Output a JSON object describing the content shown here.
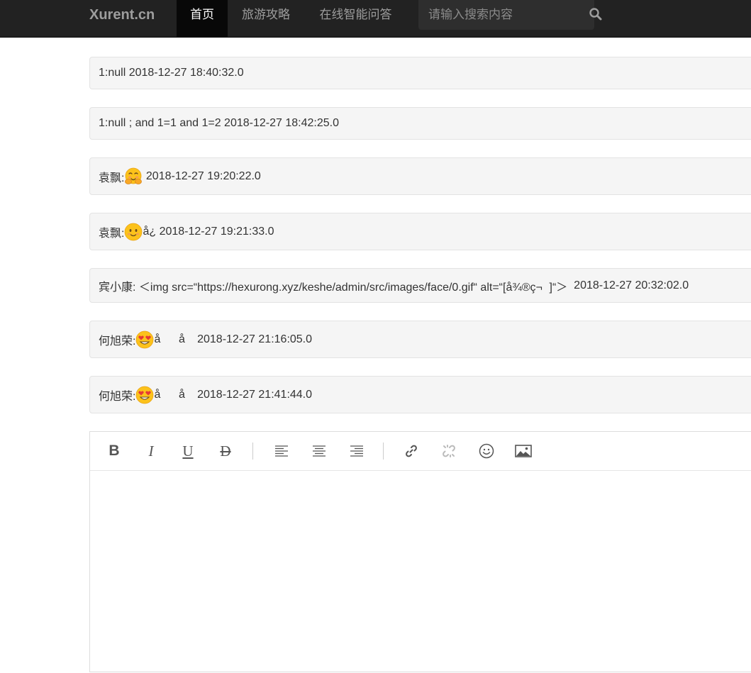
{
  "navbar": {
    "brand": "Xurent.cn",
    "items": [
      {
        "label": "首页",
        "active": true
      },
      {
        "label": "旅游攻略",
        "active": false
      },
      {
        "label": "在线智能问答",
        "active": false
      }
    ],
    "search": {
      "placeholder": "请输入搜索内容",
      "value": ""
    },
    "colors": {
      "background": "#222222",
      "active": "#080808",
      "text": "#9d9d9d"
    }
  },
  "comments": [
    {
      "author": "1",
      "prefix": "1:",
      "content": "null",
      "emoji": null,
      "tail": "",
      "timestamp": "2018-12-27 18:40:32.0"
    },
    {
      "author": "1",
      "prefix": "1:",
      "content": "null ; and 1=1 and 1=2",
      "emoji": null,
      "tail": "",
      "timestamp": "2018-12-27 18:42:25.0"
    },
    {
      "author": "袁飘",
      "prefix": "袁飘:",
      "content": "",
      "emoji": "blushing-hands-emoji-icon",
      "tail": "",
      "timestamp": "2018-12-27 19:20:22.0"
    },
    {
      "author": "袁飘",
      "prefix": "袁飘:",
      "content": "",
      "emoji": "slight-smile-emoji-icon",
      "tail": "å­¿",
      "timestamp": "2018-12-27 19:21:33.0"
    },
    {
      "author": "宾小康",
      "prefix": "宾小康:",
      "content": "＜img src=“https://hexurong.xyz/keshe/admin/src/images/face/0.gif“ alt=“[å¾®ç¬]“＞",
      "emoji": null,
      "tail": "",
      "timestamp": "2018-12-27 20:32:02.0"
    },
    {
      "author": "何旭荣",
      "prefix": "何旭荣:",
      "content": "",
      "emoji": "heart-eyes-emoji-icon",
      "tail": "åå­",
      "timestamp": "2018-12-27 21:16:05.0"
    },
    {
      "author": "何旭荣",
      "prefix": "何旭荣:",
      "content": "",
      "emoji": "heart-eyes-emoji-icon",
      "tail": "åå­",
      "timestamp": "2018-12-27 21:41:44.0"
    }
  ],
  "editor": {
    "toolbar": [
      {
        "name": "bold-button",
        "icon": "bold-icon",
        "glyph": "B"
      },
      {
        "name": "italic-button",
        "icon": "italic-icon",
        "glyph": "I"
      },
      {
        "name": "underline-button",
        "icon": "underline-icon",
        "glyph": "U"
      },
      {
        "name": "strikethrough-button",
        "icon": "strikethrough-icon",
        "glyph": "D"
      },
      {
        "name": "align-left-button",
        "icon": "align-left-icon"
      },
      {
        "name": "align-center-button",
        "icon": "align-center-icon"
      },
      {
        "name": "align-right-button",
        "icon": "align-right-icon"
      },
      {
        "name": "insert-link-button",
        "icon": "link-icon"
      },
      {
        "name": "unlink-button",
        "icon": "unlink-icon",
        "disabled": true
      },
      {
        "name": "emoji-button",
        "icon": "smiley-icon"
      },
      {
        "name": "insert-image-button",
        "icon": "image-icon"
      }
    ],
    "content": ""
  }
}
